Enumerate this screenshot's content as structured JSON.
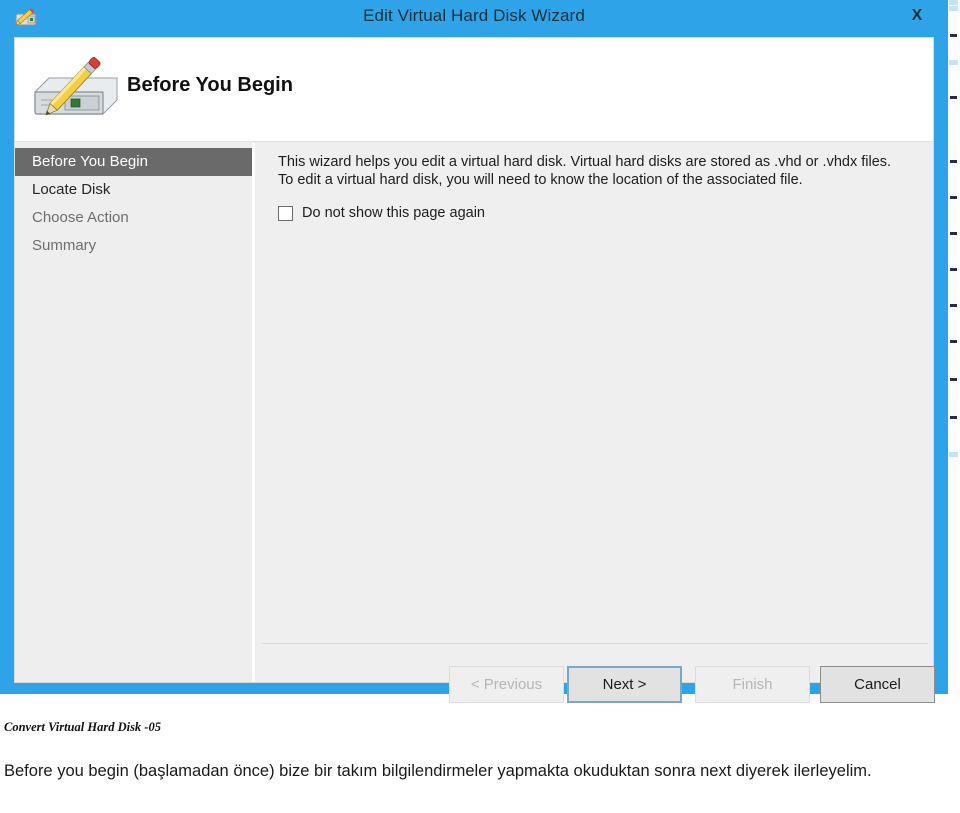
{
  "window": {
    "title": "Edit Virtual Hard Disk Wizard",
    "title_icon": "disk-pencil-icon",
    "close_label": "X",
    "frame_color": "#2fa3e8"
  },
  "banner": {
    "icon": "hard-disk-with-pencil-icon",
    "page_title": "Before You Begin"
  },
  "sidebar": {
    "items": [
      {
        "label": "Before You Begin",
        "state": "selected"
      },
      {
        "label": "Locate Disk",
        "state": "visited"
      },
      {
        "label": "Choose Action",
        "state": "normal"
      },
      {
        "label": "Summary",
        "state": "normal"
      }
    ],
    "selected_bg": "#6a6a6a",
    "selected_fg": "#ffffff"
  },
  "content": {
    "intro_text": "This wizard helps you edit a virtual hard disk. Virtual hard disks are stored as .vhd or .vhdx files. To edit a virtual hard disk, you will need to know the location of the associated file.",
    "checkbox": {
      "label": "Do not show this page again",
      "checked": false
    }
  },
  "buttons": {
    "previous": {
      "label": "< Previous",
      "enabled": false
    },
    "next": {
      "label": "Next >",
      "enabled": true,
      "is_default": true
    },
    "finish": {
      "label": "Finish",
      "enabled": false
    },
    "cancel": {
      "label": "Cancel",
      "enabled": true
    }
  },
  "caption": {
    "heading": "Convert Virtual Hard Disk -05",
    "body": "Before you begin (başlamadan önce) bize bir takım bilgilendirmeler yapmakta okuduktan sonra next diyerek ilerleyelim."
  }
}
